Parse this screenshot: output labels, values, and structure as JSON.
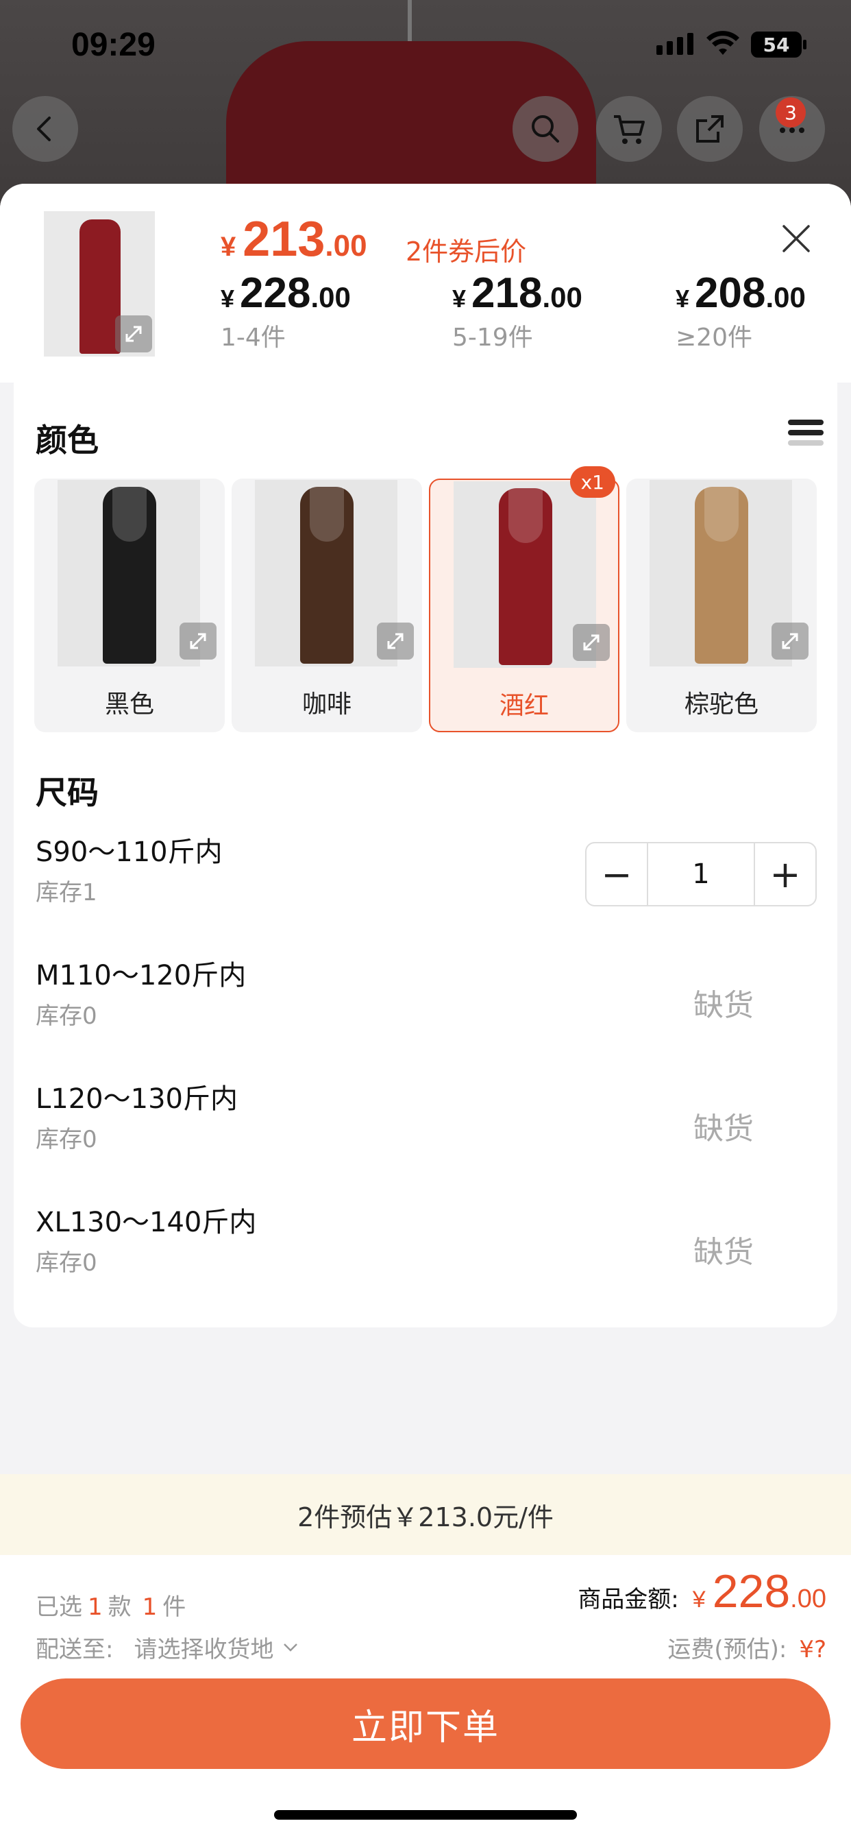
{
  "status": {
    "time": "09:29",
    "battery": "54"
  },
  "topbar": {
    "cart_badge": "3"
  },
  "header": {
    "main_price": {
      "yen": "¥",
      "int": "213",
      "dec": ".00"
    },
    "coupon_text": "2件券后价",
    "tiers": [
      {
        "yen": "¥",
        "int": "228",
        "dec": ".00",
        "qty": "1-4件"
      },
      {
        "yen": "¥",
        "int": "218",
        "dec": ".00",
        "qty": "5-19件"
      },
      {
        "yen": "¥",
        "int": "208",
        "dec": ".00",
        "qty": "≥20件"
      }
    ]
  },
  "color_section": {
    "title": "颜色",
    "options": [
      {
        "name": "黑色",
        "swatch": "#1c1c1c"
      },
      {
        "name": "咖啡",
        "swatch": "#4a2e1f"
      },
      {
        "name": "酒红",
        "swatch": "#8d1b22",
        "selected": true,
        "count": "x1"
      },
      {
        "name": "棕驼色",
        "swatch": "#b58a5c"
      }
    ]
  },
  "size_section": {
    "title": "尺码",
    "rows": [
      {
        "label": "S90～110斤内",
        "stock": "库存1",
        "quantity": "1"
      },
      {
        "label": "M110～120斤内",
        "stock": "库存0",
        "status": "缺货"
      },
      {
        "label": "L120～130斤内",
        "stock": "库存0",
        "status": "缺货"
      },
      {
        "label": "XL130～140斤内",
        "stock": "库存0",
        "status": "缺货"
      }
    ]
  },
  "estimate": "2件预估￥213.0元/件",
  "summary": {
    "picked_prefix": "已选",
    "picked_styles": "1",
    "picked_styles_unit": "款",
    "picked_items": "1",
    "picked_items_unit": "件",
    "deliver_label": "配送至:",
    "deliver_value": "请选择收货地",
    "amount_label": "商品金额:",
    "amount_yen": "¥",
    "amount_int": "228",
    "amount_dec": ".00",
    "shipping_label": "运费(预估):",
    "shipping_value": "¥?"
  },
  "buy_button": "立即下单",
  "colors": {
    "accent": "#e8522a",
    "button": "#ec6b3f",
    "estimate_bg": "#fbf7e8"
  }
}
